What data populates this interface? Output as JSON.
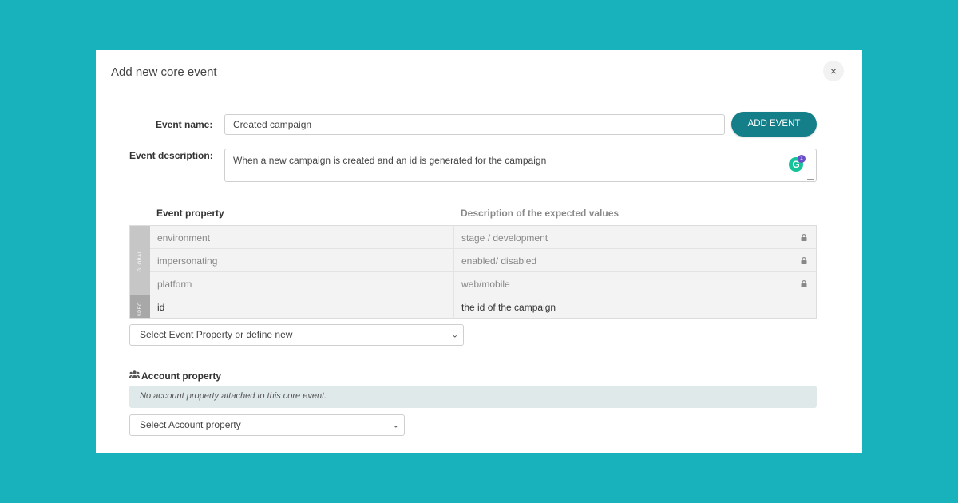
{
  "modal": {
    "title": "Add new core event",
    "close_label": "×"
  },
  "form": {
    "event_name_label": "Event name:",
    "event_name_value": "Created campaign",
    "add_event_label": "ADD EVENT",
    "event_description_label": "Event description:",
    "event_description_value": "When a new campaign is created and an id is generated for the campaign",
    "grammarly_letter": "G",
    "grammarly_count": "1"
  },
  "properties": {
    "col_property": "Event property",
    "col_description": "Description of the expected values",
    "groups": [
      {
        "label": "GLOBAL"
      },
      {
        "label": "SPEC..."
      }
    ],
    "rows": [
      {
        "name": "environment",
        "description": "stage / development",
        "locked": true
      },
      {
        "name": "impersonating",
        "description": "enabled/ disabled",
        "locked": true
      },
      {
        "name": "platform",
        "description": "web/mobile",
        "locked": true
      },
      {
        "name": "id",
        "description": "the id of the campaign",
        "locked": false
      }
    ],
    "select_placeholder": "Select Event Property or define new"
  },
  "account": {
    "title": "Account property",
    "empty_message": "No account property attached to this core event.",
    "select_placeholder": "Select Account property"
  },
  "colors": {
    "background": "#18b2bd",
    "primary_button": "#147f88",
    "info_box": "#dfe9ea"
  }
}
